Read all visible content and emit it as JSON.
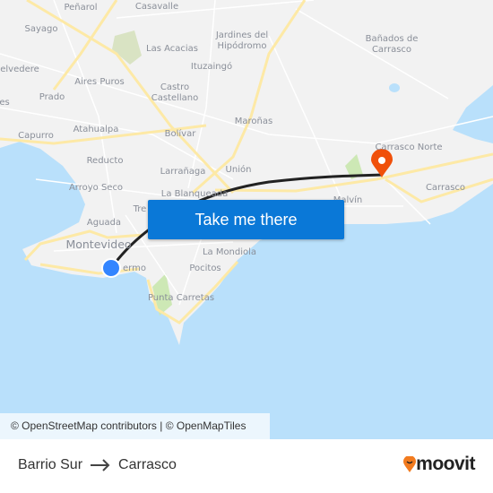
{
  "map": {
    "labels": {
      "penarol": "Peñarol",
      "casavalle": "Casavalle",
      "sayago": "Sayago",
      "jardines1": "Jardines del",
      "jardines2": "Hipódromo",
      "banados1": "Bañados de",
      "banados2": "Carrasco",
      "las_acacias": "Las Acacias",
      "belvedere": "elvedere",
      "ituzaingo": "Ituzaingó",
      "aires_puros": "Aires Puros",
      "castro1": "Castro",
      "castro2": "Castellano",
      "prado": "Prado",
      "es": "es",
      "marona": "Maroñas",
      "capurro": "Capurro",
      "atahualpa": "Atahualpa",
      "bolivar": "Bolívar",
      "carrasco_norte": "Carrasco Norte",
      "reducto": "Reducto",
      "larranaga": "Larrañaga",
      "union": "Unión",
      "carrasco": "Carrasco",
      "arroyo_seco": "Arroyo Seco",
      "la_blanqueada": "La Blanqueada",
      "malvin": "Malvín",
      "tres": "Tre",
      "aguada": "Aguada",
      "montevideo": "Montevideo",
      "la_mondiola": "La Mondiola",
      "palermo": "ermo",
      "pocitos": "Pocitos",
      "punta_carretas": "Punta Carretas"
    },
    "colors": {
      "water": "#b9e0fb",
      "land": "#f2f2f2",
      "road": "#fde9a6",
      "route": "#222222",
      "origin": "#3385ff",
      "destination": "#f0500a"
    },
    "origin_icon": "origin-dot-icon",
    "destination_icon": "map-pin-icon"
  },
  "cta": {
    "label": "Take me there"
  },
  "attribution": "© OpenStreetMap contributors | © OpenMapTiles",
  "footer": {
    "from": "Barrio Sur",
    "to": "Carrasco",
    "arrow_icon": "arrow-right-icon",
    "brand": "moovit"
  }
}
